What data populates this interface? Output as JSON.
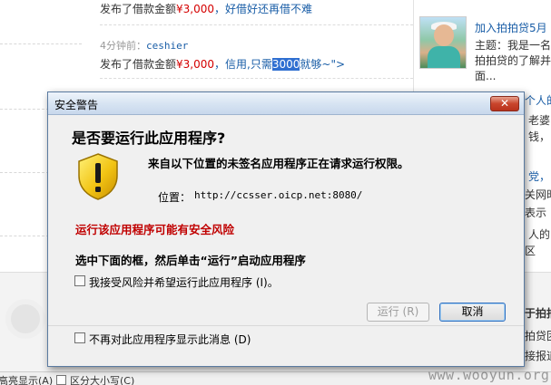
{
  "feed": {
    "item1": {
      "prefix": "发布了借款金额",
      "amount": "¥3,000",
      "sep": "，",
      "link": "好借好还再借不难"
    },
    "item2_meta": {
      "time": "4分钟前：",
      "user": "ceshier"
    },
    "item2": {
      "prefix": "发布了借款金额",
      "amount": "¥3,000",
      "sep": "，",
      "link_a": "信用,只需",
      "highlight": "3000",
      "link_b": "就够~\">"
    }
  },
  "right_col": {
    "title": "加入拍拍贷5月",
    "body": "主题：我是一名\n拍拍贷的了解并\n面...",
    "frag1": "个人的",
    "frag2": "老婆",
    "frag3": "钱，",
    "frag4": "党，",
    "frag5": "关网时",
    "frag6": "表示",
    "frag7": "人的",
    "frag8": "区",
    "bottom1": "于拍拍",
    "bottom2": "拍贷团",
    "bottom3": "接报道"
  },
  "findbar": {
    "highlight_label": "高亮显示(A)",
    "match_case_label": "区分大小写(C)"
  },
  "watermark": "www.wooyun.org",
  "dialog": {
    "title": "安全警告",
    "close_glyph": "✕",
    "heading": "是否要运行此应用程序?",
    "message": "来自以下位置的未签名应用程序正在请求运行权限。",
    "location_label": "位置：",
    "location_value": "http://ccsser.oicp.net:8080/",
    "risk": "运行该应用程序可能有安全风险",
    "instruction": "选中下面的框，然后单击“运行”启动应用程序",
    "accept_label": "我接受风险并希望运行此应用程序 (I)。",
    "run_button": "运行 (R)",
    "cancel_button": "取消",
    "dont_show_label": "不再对此应用程序显示此消息 (D)"
  },
  "colors": {
    "amount": "#d40000",
    "link": "#1a5ea7",
    "risk": "#c00000",
    "close_button": "#c9452c"
  },
  "icons": {
    "warning": "warning-shield-icon",
    "close": "close-icon",
    "avatar": "user-avatar"
  }
}
